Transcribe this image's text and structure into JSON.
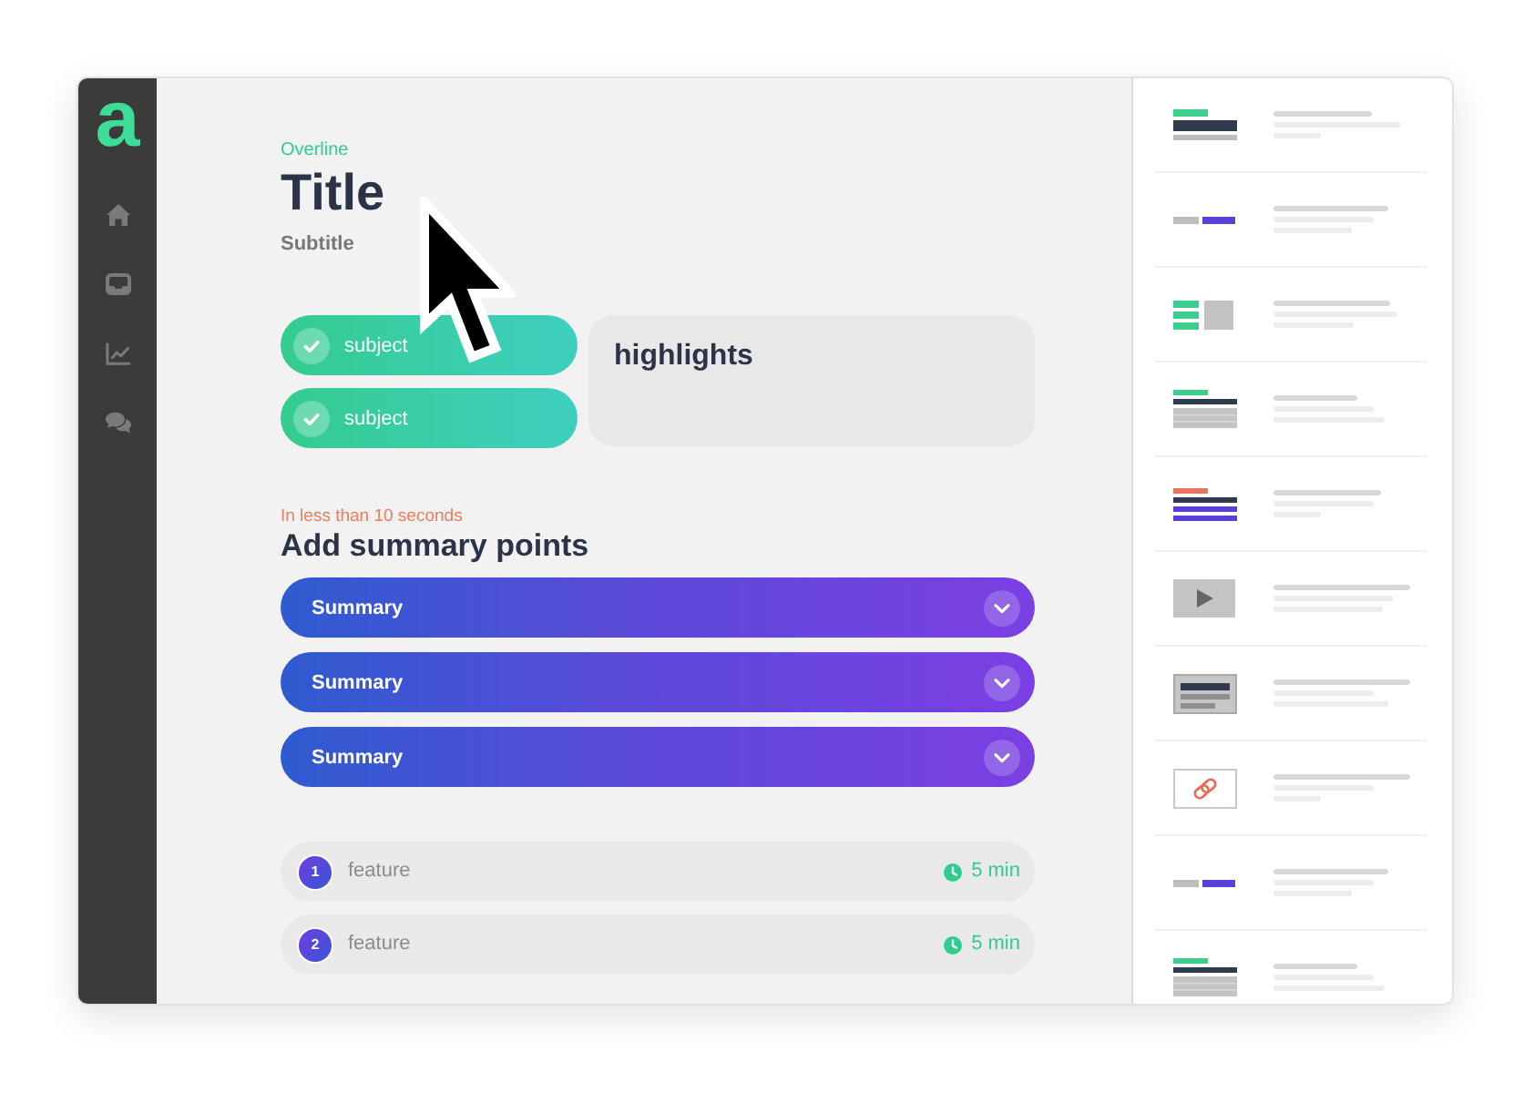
{
  "sidebar": {
    "logo": "a",
    "items": [
      {
        "kind": "home"
      },
      {
        "kind": "inbox"
      },
      {
        "kind": "chart"
      },
      {
        "kind": "chat"
      }
    ]
  },
  "header": {
    "overline": "Overline",
    "title": "Title",
    "subtitle": "Subtitle"
  },
  "subjects": [
    {
      "label": "subject",
      "checked": true
    },
    {
      "label": "subject",
      "checked": true
    }
  ],
  "highlights": {
    "title": "highlights"
  },
  "summary": {
    "hint": "In less than 10 seconds",
    "heading": "Add summary points",
    "items": [
      {
        "label": "Summary",
        "expanded": false
      },
      {
        "label": "Summary",
        "expanded": false
      },
      {
        "label": "Summary",
        "expanded": false
      }
    ]
  },
  "features": [
    {
      "number": "1",
      "label": "feature",
      "duration": "5 min"
    },
    {
      "number": "2",
      "label": "feature",
      "duration": "5 min"
    }
  ],
  "templates": [
    {
      "kind": "heading"
    },
    {
      "kind": "buttons"
    },
    {
      "kind": "checklist"
    },
    {
      "kind": "text"
    },
    {
      "kind": "alert"
    },
    {
      "kind": "video"
    },
    {
      "kind": "card"
    },
    {
      "kind": "link"
    },
    {
      "kind": "buttons"
    },
    {
      "kind": "text"
    }
  ]
}
